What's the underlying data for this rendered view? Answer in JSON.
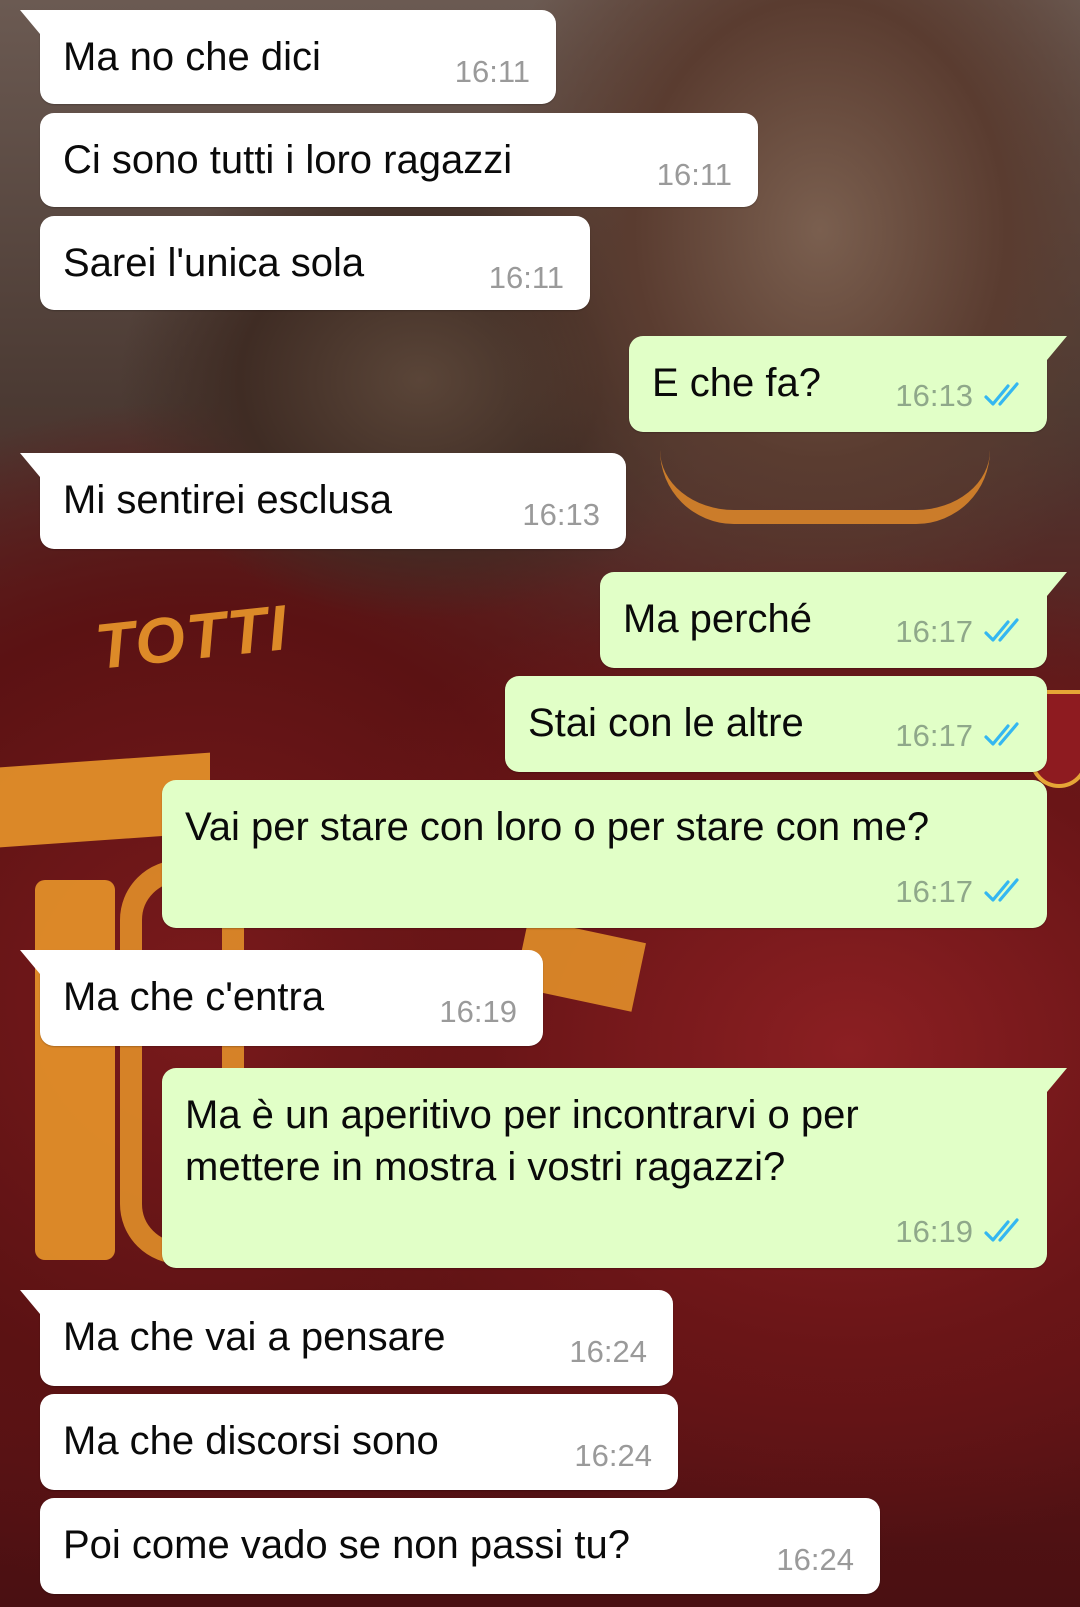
{
  "colors": {
    "incoming_bubble": "#ffffff",
    "outgoing_bubble": "#e1ffc7",
    "read_ticks": "#34b7f1",
    "time_text": "#9a9a9a"
  },
  "wallpaper": {
    "jersey_name": "TOTTI"
  },
  "messages": [
    {
      "dir": "in",
      "text": "Ma no che dici",
      "time": "16:11",
      "status": ""
    },
    {
      "dir": "in",
      "text": "Ci sono tutti i loro ragazzi",
      "time": "16:11",
      "status": ""
    },
    {
      "dir": "in",
      "text": "Sarei l'unica sola",
      "time": "16:11",
      "status": ""
    },
    {
      "dir": "out",
      "text": "E che fa?",
      "time": "16:13",
      "status": "read"
    },
    {
      "dir": "in",
      "text": "Mi sentirei esclusa",
      "time": "16:13",
      "status": ""
    },
    {
      "dir": "out",
      "text": "Ma perché",
      "time": "16:17",
      "status": "read"
    },
    {
      "dir": "out",
      "text": "Stai con le altre",
      "time": "16:17",
      "status": "read"
    },
    {
      "dir": "out",
      "text": "Vai per stare con loro o per stare con me?",
      "time": "16:17",
      "status": "read"
    },
    {
      "dir": "in",
      "text": "Ma che c'entra",
      "time": "16:19",
      "status": ""
    },
    {
      "dir": "out",
      "text": "Ma è un aperitivo per incontrarvi o per\nmettere in mostra i vostri ragazzi?",
      "time": "16:19",
      "status": "read"
    },
    {
      "dir": "in",
      "text": "Ma che vai a pensare",
      "time": "16:24",
      "status": ""
    },
    {
      "dir": "in",
      "text": "Ma che discorsi sono",
      "time": "16:24",
      "status": ""
    },
    {
      "dir": "in",
      "text": "Poi come vado se non passi tu?",
      "time": "16:24",
      "status": ""
    }
  ]
}
